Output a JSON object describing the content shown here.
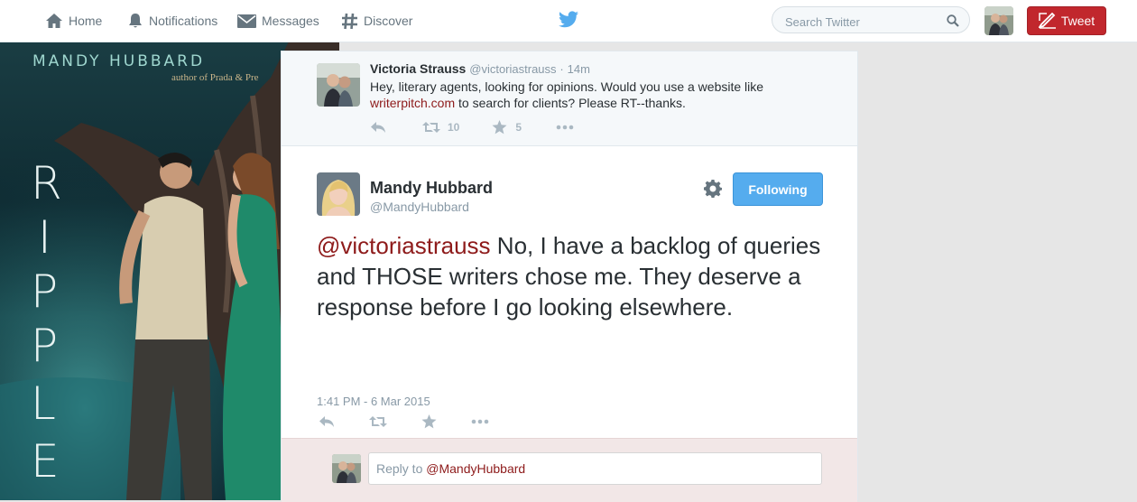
{
  "nav": {
    "home": "Home",
    "notifications": "Notifications",
    "messages": "Messages",
    "discover": "Discover",
    "search_placeholder": "Search Twitter",
    "tweet_button": "Tweet"
  },
  "background": {
    "author": "MANDY HUBBARD",
    "subtitle": "author of Prada & Pre",
    "title_letters": [
      "R",
      "I",
      "P",
      "P",
      "L",
      "E"
    ]
  },
  "context_tweet": {
    "name": "Victoria Strauss",
    "handle": "@victoriastrauss",
    "separator": "·",
    "time": "14m",
    "text_before": "Hey, literary agents, looking for opinions. Would you use a website like",
    "link": "writerpitch.com",
    "text_after": " to search for clients? Please RT--thanks.",
    "retweets": "10",
    "favorites": "5"
  },
  "main_tweet": {
    "name": "Mandy Hubbard",
    "handle": "@MandyHubbard",
    "follow_label": "Following",
    "mention": "@victoriastrauss",
    "text": " No, I have a backlog of queries and THOSE writers chose me. They deserve a response before I go looking elsewhere.",
    "timestamp": "1:41 PM - 6 Mar 2015"
  },
  "reply": {
    "prefix": "Reply to ",
    "mention": "@MandyHubbard"
  },
  "colors": {
    "link": "#8e1b1b",
    "follow_button": "#55acee",
    "tweet_button": "#c1272d",
    "twitter_blue": "#55acee"
  }
}
